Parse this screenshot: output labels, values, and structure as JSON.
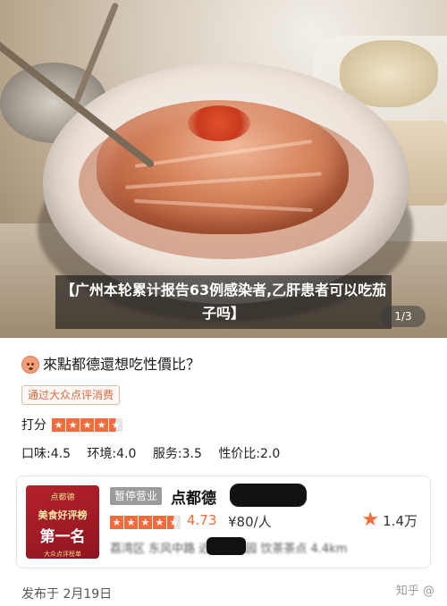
{
  "photo": {
    "caption": "【广州本轮累计报告63例感染者,乙肝患者可以吃茄子吗】",
    "pager": "1/3"
  },
  "post": {
    "question": "來點都德還想吃性價比？",
    "source_tag": "通过大众点评消费",
    "rating_label": "打分",
    "rating_stars": 4.5,
    "scores": {
      "taste": "口味:4.5",
      "environment": "环境:4.0",
      "service": "服务:3.5",
      "value": "性价比:2.0"
    },
    "posted_date": "发布于 2月19日"
  },
  "shop_card": {
    "badge": {
      "brand": "点都德",
      "title": "美食好评榜",
      "rank": "第一名",
      "sub": "大众点评榜单"
    },
    "status": "暂停营业",
    "name": "点都德",
    "rating_stars": 4.5,
    "score": "4.73",
    "price": "¥80/人",
    "favorites": "1.4万",
    "location": "荔湾区 东风中路 近华侨公园 饮茶茶点 4.4km"
  },
  "watermark": "知乎 @",
  "colors": {
    "accent": "#f36b3b",
    "badge_red": "#b5222b",
    "status_gray": "#9b9b9b"
  }
}
